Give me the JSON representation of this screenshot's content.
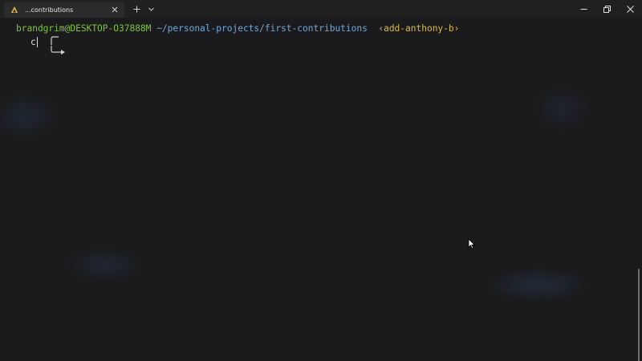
{
  "titlebar": {
    "tab_title": "...contributions",
    "tab_icon": "terminal-app-icon",
    "tab_close_icon": "close-icon",
    "new_tab_icon": "plus-icon",
    "dropdown_icon": "chevron-down-icon",
    "window_controls": [
      "minimize-icon",
      "maximize-icon",
      "close-icon"
    ]
  },
  "prompt": {
    "user": "brandgrim",
    "at": "@",
    "host": "DESKTOP-O37888M",
    "path": "~/personal-projects/first-contributions",
    "branch": "‹add-anthony-b›"
  },
  "input": {
    "typed": "c"
  },
  "colors": {
    "background": "#1b1b1d",
    "titlebar": "#202020",
    "user_host": "#7ec33a",
    "path": "#6fa8dc",
    "branch": "#d7b94a"
  }
}
